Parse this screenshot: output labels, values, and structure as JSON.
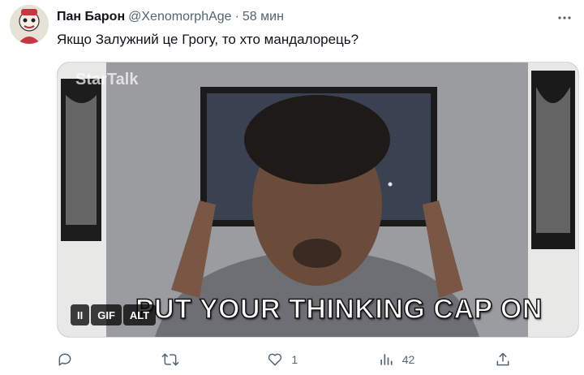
{
  "tweet": {
    "display_name": "Пан Барон",
    "handle": "@XenomorphAge",
    "separator": "·",
    "time": "58 мин",
    "text": "Якщо Залужний це Грогу, то хто мандалорець?"
  },
  "media": {
    "watermark": "StarTalk",
    "caption": "PUT YOUR THINKING CAP ON",
    "pause_label": "II",
    "gif_label": "GIF",
    "alt_label": "ALT"
  },
  "actions": {
    "reply_count": "",
    "retweet_count": "",
    "like_count": "1",
    "views_count": "42"
  },
  "icons": {
    "more": "more-icon",
    "reply": "reply-icon",
    "retweet": "retweet-icon",
    "like": "heart-icon",
    "views": "views-icon",
    "share": "share-icon"
  },
  "colors": {
    "secondary_text": "#536471",
    "border": "#cfd9de"
  }
}
